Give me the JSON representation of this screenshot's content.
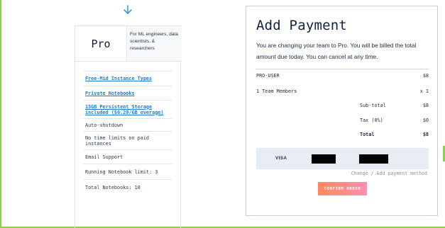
{
  "plan": {
    "name": "Pro",
    "description": "For ML engineers, data scientists, & researchers",
    "features": [
      {
        "label": "Free-Mid Instance Types",
        "link": true
      },
      {
        "label": "Private Notebooks",
        "link": true
      },
      {
        "label": "15GB Persistent Storage included ($0.29/GB overage)",
        "link": true
      },
      {
        "label": "Auto-shutdown",
        "link": false
      },
      {
        "label": "No time limits on paid instances",
        "link": false
      },
      {
        "label": "Email Support",
        "link": false
      },
      {
        "label": "Running Notebook limit: 3",
        "link": false
      },
      {
        "label": "Total Notebooks: 10",
        "link": false
      }
    ]
  },
  "payment": {
    "title": "Add Payment",
    "intro": "You are changing your team to Pro. You will be billed the total amount due today. You can cancel at any time.",
    "line_item": {
      "label": "PRO-USER",
      "price": "$8"
    },
    "members": {
      "label": "1 Team Members",
      "qty": "x 1"
    },
    "subtotal": {
      "label": "Sub-total",
      "value": "$8"
    },
    "tax": {
      "label": "Tax (0%)",
      "value": "$0"
    },
    "total": {
      "label": "Total",
      "value": "$8"
    },
    "card_brand": "VISA",
    "change_link": "Change / Add payment method",
    "confirm_label": "CONFIRM ORDER"
  },
  "colors": {
    "accent_link": "#1f7bd8",
    "button_start": "#ff8a5b",
    "button_end": "#ff8fb0",
    "frame": "#8fd14f"
  },
  "icons": {
    "top_arrow": "arrow-down-icon"
  }
}
